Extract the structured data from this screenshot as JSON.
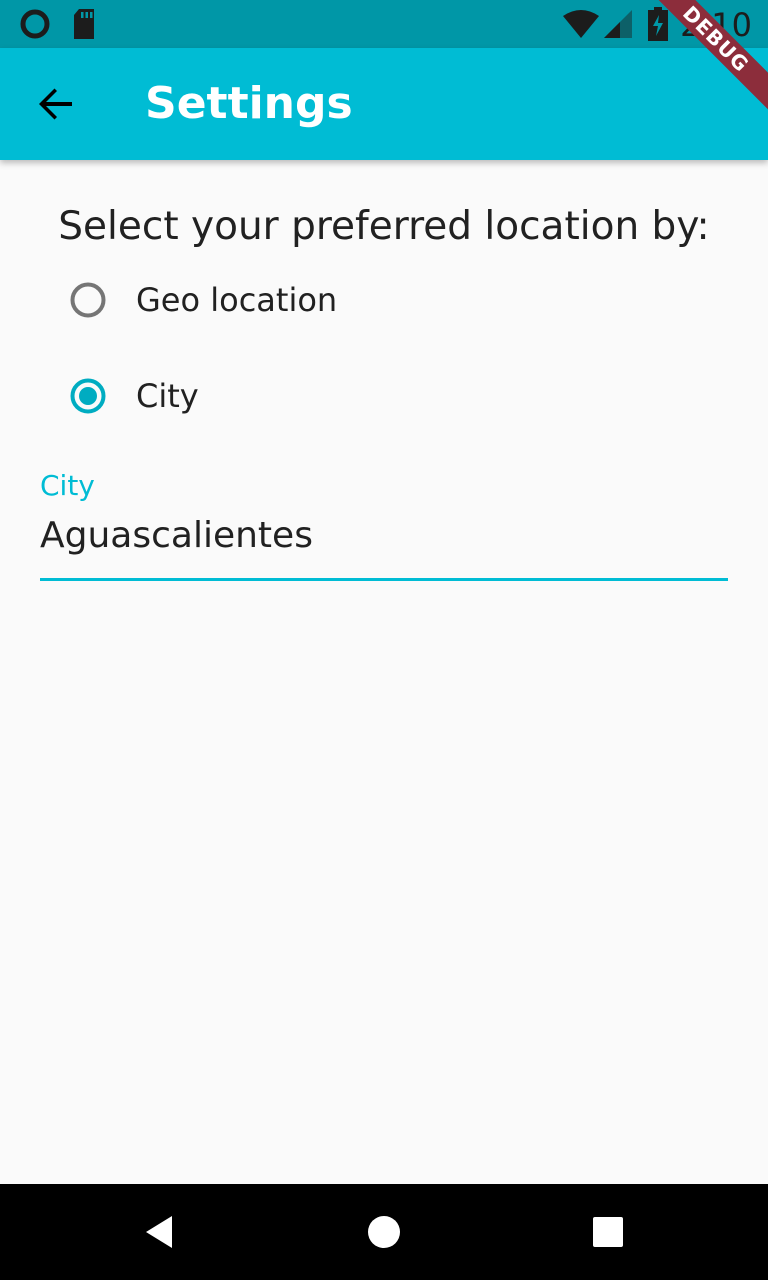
{
  "status_bar": {
    "time": "2:10",
    "icons": [
      "notification-circle-icon",
      "sd-card-icon",
      "wifi-icon",
      "cell-signal-icon",
      "battery-charging-icon"
    ]
  },
  "debug_banner": "DEBUG",
  "app_bar": {
    "title": "Settings",
    "back_icon": "arrow-back-icon",
    "color": "#00bcd4"
  },
  "settings": {
    "prompt": "Select your preferred location by:",
    "options": [
      {
        "label": "Geo location",
        "selected": false
      },
      {
        "label": "City",
        "selected": true
      }
    ]
  },
  "city_field": {
    "label": "City",
    "value": "Aguascalientes"
  },
  "nav_bar": {
    "icons": [
      "back-triangle-icon",
      "home-circle-icon",
      "recents-square-icon"
    ]
  },
  "colors": {
    "accent": "#00bcd4",
    "status_bar": "#0097a7",
    "radio_selected": "#00acc1",
    "radio_unselected": "#757575"
  }
}
